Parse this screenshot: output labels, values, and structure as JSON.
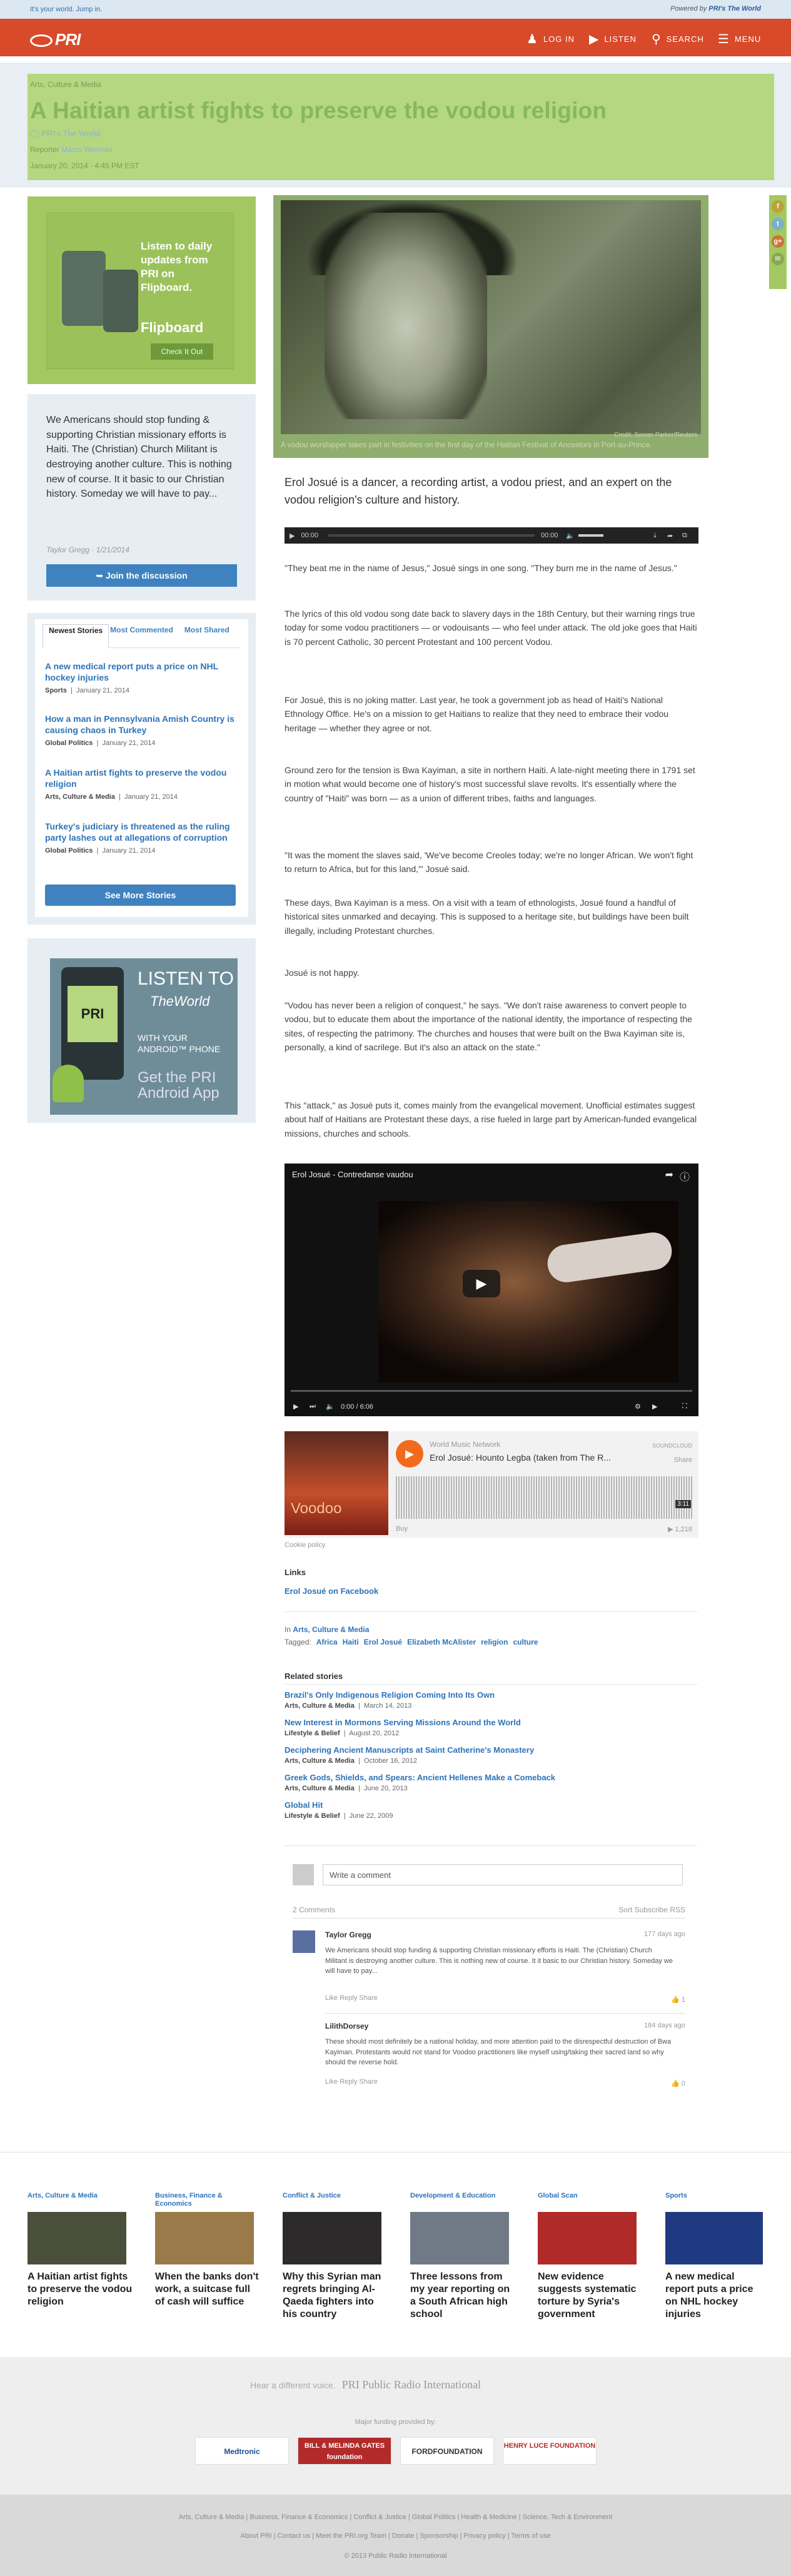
{
  "topbar": {
    "tagline": "It's your world. Jump in.",
    "powered_label": "Powered by",
    "powered_brand": "PRI's The World"
  },
  "nav": {
    "logo": "PRI",
    "login": "LOG IN",
    "listen": "LISTEN",
    "search": "SEARCH",
    "menu": "MENU"
  },
  "header": {
    "category": "Arts, Culture & Media",
    "title": "A Haitian artist fights to preserve the vodou religion",
    "source": "PRI's The World",
    "reporter_label": "Reporter",
    "reporter": "Marco Werman",
    "date": "January 20, 2014 · 4:45 PM EST"
  },
  "social": [
    "f",
    "t",
    "g+",
    "✉"
  ],
  "promo": {
    "text": "Listen to daily updates from PRI on Flipboard.",
    "brand": "Flipboard",
    "button": "Check It Out"
  },
  "community": {
    "quote": "We Americans should stop funding & supporting Christian missionary efforts is Haiti. The (Christian) Church Militant is destroying another culture. This is nothing new of course. It it basic to our Christian history. Someday we will have to pay...",
    "byline": "Taylor Gregg · 1/21/2014",
    "join": "Join the discussion"
  },
  "most": {
    "tabs": [
      "Newest Stories",
      "Most Commented",
      "Most Shared"
    ],
    "stories": [
      {
        "title": "A new medical report puts a price on NHL hockey injuries",
        "cat": "Sports",
        "date": "January 21, 2014"
      },
      {
        "title": "How a man in Pennsylvania Amish Country is causing chaos in Turkey",
        "cat": "Global Politics",
        "date": "January 21, 2014"
      },
      {
        "title": "A Haitian artist fights to preserve the vodou religion",
        "cat": "Arts, Culture & Media",
        "date": "January 21, 2014"
      },
      {
        "title": "Turkey's judiciary is threatened as the ruling party lashes out at allegations of corruption",
        "cat": "Global Politics",
        "date": "January 21, 2014"
      }
    ],
    "see_more": "See More Stories"
  },
  "ad": {
    "listen": "LISTEN TO",
    "world": "TheWorld",
    "phone": "WITH YOUR ANDROID™ PHONE",
    "get": "Get the PRI Android App",
    "screen": "PRI"
  },
  "hero": {
    "credit": "Credit: Swoan Parker/Reuters",
    "caption": "A vodou worshipper takes part in festivities on the first day of the Haitian Festival of Ancestors in Port-au-Prince."
  },
  "article": {
    "lead": "Erol Josué is a dancer, a recording artist, a vodou priest, and an expert on the vodou religion's culture and history.",
    "player": {
      "t1": "00:00",
      "t2": "00:00"
    },
    "paragraphs": [
      "\"They beat me in the name of Jesus,\" Josué sings in one song. \"They burn me in the name of Jesus.\"",
      "The lyrics of this old vodou song date back to slavery days in the 18th Century, but their warning rings true today for some vodou practitioners — or vodouisants — who feel under attack. The old joke goes that Haiti is 70 percent Catholic, 30 percent Protestant and 100 percent Vodou.",
      "For Josué, this is no joking matter. Last year, he took a government job as head of Haiti's National Ethnology Office. He's on a mission to get Haitians to realize that they need to embrace their vodou heritage — whether they agree or not.",
      "Ground zero for the tension is Bwa Kayiman, a site in northern Haiti. A late-night meeting there in 1791 set in motion what would become one of history's most successful slave revolts. It's essentially where the country of \"Haiti\" was born — as a union of different tribes, faiths and languages.",
      "\"It was the moment the slaves said, 'We've become Creoles today; we're no longer African. We won't fight to return to Africa, but for this land,'\" Josué said.",
      "These days, Bwa Kayiman is a mess. On a visit with a team of ethnologists, Josué found a handful of historical sites unmarked and decaying. This is supposed to a heritage site, but buildings have been built illegally, including Protestant churches.",
      "Josué is not happy.",
      "\"Vodou has never been a religion of conquest,\" he says. \"We don't raise awareness to convert people to vodou, but to educate them about the importance of the national identity, the importance of respecting the sites, of respecting the patrimony. The churches and houses that were built on the Bwa Kayiman site is, personally, a kind of sacrilege. But it's also an attack on the state.\"",
      "This \"attack,\" as Josué puts it, comes mainly from the evangelical movement. Unofficial estimates suggest about half of Haitians are Protestant these days, a rise fueled in large part by American-funded evangelical missions, churches and schools."
    ]
  },
  "video": {
    "title": "Erol Josué - Contredanse vaudou",
    "time": "0:00 / 6:06"
  },
  "soundcloud": {
    "network": "World Music Network",
    "track": "Erol Josué: Hounto Legba (taken from The R...",
    "art": "Voodoo",
    "brand": "SOUNDCLOUD",
    "share": "Share",
    "buy": "Buy",
    "count": "▶ 1,218",
    "duration": "3:11",
    "cookie": "Cookie policy"
  },
  "links": {
    "heading": "Links",
    "items": [
      "Erol Josué on Facebook"
    ]
  },
  "filed": {
    "in_label": "In",
    "category": "Arts, Culture & Media",
    "tagged_label": "Tagged:",
    "tags": [
      "Africa",
      "Haiti",
      "Erol Josué",
      "Elizabeth McAlister",
      "religion",
      "culture"
    ]
  },
  "related": {
    "heading": "Related stories",
    "items": [
      {
        "title": "Brazil's Only Indigenous Religion Coming Into Its Own",
        "cat": "Arts, Culture & Media",
        "date": "March 14, 2013"
      },
      {
        "title": "New Interest in Mormons Serving Missions Around the World",
        "cat": "Lifestyle & Belief",
        "date": "August 20, 2012"
      },
      {
        "title": "Deciphering Ancient Manuscripts at Saint Catherine's Monastery",
        "cat": "Arts, Culture & Media",
        "date": "October 16, 2012"
      },
      {
        "title": "Greek Gods, Shields, and Spears: Ancient Hellenes Make a Comeback",
        "cat": "Arts, Culture & Media",
        "date": "June 20, 2013"
      },
      {
        "title": "Global Hit",
        "cat": "Lifestyle & Belief",
        "date": "June 22, 2009"
      }
    ]
  },
  "comments": {
    "placeholder": "Write a comment",
    "count": "2 Comments",
    "sort": "Sort Subscribe RSS",
    "items": [
      {
        "name": "Taylor Gregg",
        "ago": "177 days ago",
        "text": "We Americans should stop funding & supporting Christian missionary efforts is Haiti. The (Christian) Church Militant is destroying another culture. This is nothing new of course. It it basic to our Christian history. Someday we will have to pay...",
        "actions": "Like  Reply  Share",
        "votes": "1"
      },
      {
        "name": "LilithDorsey",
        "ago": "184 days ago",
        "text": "These should most definitely be a national holiday, and more attention paid to the disrespectful destruction of Bwa Kayiman. Protestants would not stand for Voodoo practitioners like myself using/taking their sacred land so why should the reverse hold.",
        "actions": "Like  Reply  Share",
        "votes": "0"
      }
    ]
  },
  "bottom": [
    {
      "cat": "Arts, Culture & Media",
      "title": "A Haitian artist fights to preserve the vodou religion",
      "color": "#4a4f3c"
    },
    {
      "cat": "Business, Finance & Economics",
      "title": "When the banks don't work, a suitcase full of cash will suffice",
      "color": "#9a7a48"
    },
    {
      "cat": "Conflict & Justice",
      "title": "Why this Syrian man regrets bringing Al-Qaeda fighters into his country",
      "color": "#2c2a2a"
    },
    {
      "cat": "Development & Education",
      "title": "Three lessons from my year reporting on a South African high school",
      "color": "#6f7a86"
    },
    {
      "cat": "Global Scan",
      "title": "New evidence suggests systematic torture by Syria's government",
      "color": "#b02a2a"
    },
    {
      "cat": "Sports",
      "title": "A new medical report puts a price on NHL hockey injuries",
      "color": "#1f3a80"
    }
  ],
  "footer": {
    "hear": "Hear a different voice.",
    "pri": "PRI Public Radio International",
    "funding": "Major funding provided by:",
    "sponsors": [
      "Medtronic",
      "BILL & MELINDA GATES foundation",
      "FORDFOUNDATION",
      "HENRY LUCE FOUNDATION"
    ],
    "row1": "Arts, Culture & Media  |  Business, Finance & Economics  |  Conflict & Justice  |  Global Politics  |  Health & Medicine  |  Science, Tech & Environment",
    "row2": "About PRI  |  Contact us  |  Meet the PRI.org Team  |  Donate  |  Sponsorship  |  Privacy policy  |  Terms of use",
    "copyright": "© 2013 Public Radio International"
  }
}
